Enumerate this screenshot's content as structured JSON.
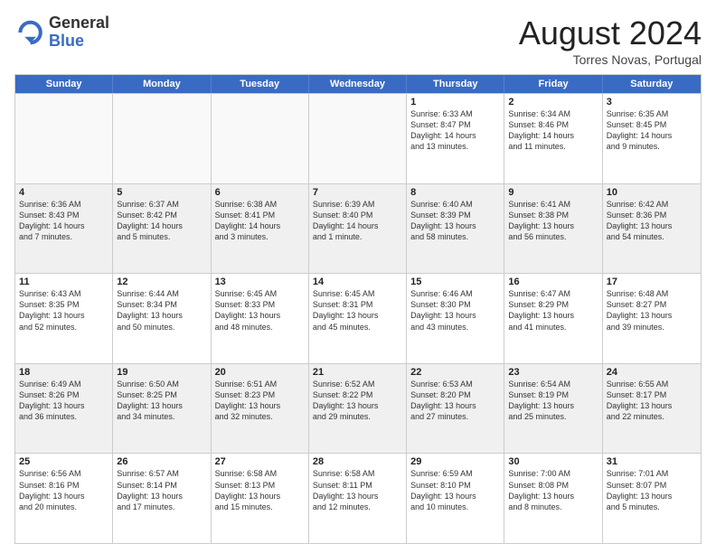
{
  "logo": {
    "general": "General",
    "blue": "Blue"
  },
  "title": "August 2024",
  "subtitle": "Torres Novas, Portugal",
  "header_days": [
    "Sunday",
    "Monday",
    "Tuesday",
    "Wednesday",
    "Thursday",
    "Friday",
    "Saturday"
  ],
  "weeks": [
    [
      {
        "day": "",
        "text": ""
      },
      {
        "day": "",
        "text": ""
      },
      {
        "day": "",
        "text": ""
      },
      {
        "day": "",
        "text": ""
      },
      {
        "day": "1",
        "text": "Sunrise: 6:33 AM\nSunset: 8:47 PM\nDaylight: 14 hours\nand 13 minutes."
      },
      {
        "day": "2",
        "text": "Sunrise: 6:34 AM\nSunset: 8:46 PM\nDaylight: 14 hours\nand 11 minutes."
      },
      {
        "day": "3",
        "text": "Sunrise: 6:35 AM\nSunset: 8:45 PM\nDaylight: 14 hours\nand 9 minutes."
      }
    ],
    [
      {
        "day": "4",
        "text": "Sunrise: 6:36 AM\nSunset: 8:43 PM\nDaylight: 14 hours\nand 7 minutes."
      },
      {
        "day": "5",
        "text": "Sunrise: 6:37 AM\nSunset: 8:42 PM\nDaylight: 14 hours\nand 5 minutes."
      },
      {
        "day": "6",
        "text": "Sunrise: 6:38 AM\nSunset: 8:41 PM\nDaylight: 14 hours\nand 3 minutes."
      },
      {
        "day": "7",
        "text": "Sunrise: 6:39 AM\nSunset: 8:40 PM\nDaylight: 14 hours\nand 1 minute."
      },
      {
        "day": "8",
        "text": "Sunrise: 6:40 AM\nSunset: 8:39 PM\nDaylight: 13 hours\nand 58 minutes."
      },
      {
        "day": "9",
        "text": "Sunrise: 6:41 AM\nSunset: 8:38 PM\nDaylight: 13 hours\nand 56 minutes."
      },
      {
        "day": "10",
        "text": "Sunrise: 6:42 AM\nSunset: 8:36 PM\nDaylight: 13 hours\nand 54 minutes."
      }
    ],
    [
      {
        "day": "11",
        "text": "Sunrise: 6:43 AM\nSunset: 8:35 PM\nDaylight: 13 hours\nand 52 minutes."
      },
      {
        "day": "12",
        "text": "Sunrise: 6:44 AM\nSunset: 8:34 PM\nDaylight: 13 hours\nand 50 minutes."
      },
      {
        "day": "13",
        "text": "Sunrise: 6:45 AM\nSunset: 8:33 PM\nDaylight: 13 hours\nand 48 minutes."
      },
      {
        "day": "14",
        "text": "Sunrise: 6:45 AM\nSunset: 8:31 PM\nDaylight: 13 hours\nand 45 minutes."
      },
      {
        "day": "15",
        "text": "Sunrise: 6:46 AM\nSunset: 8:30 PM\nDaylight: 13 hours\nand 43 minutes."
      },
      {
        "day": "16",
        "text": "Sunrise: 6:47 AM\nSunset: 8:29 PM\nDaylight: 13 hours\nand 41 minutes."
      },
      {
        "day": "17",
        "text": "Sunrise: 6:48 AM\nSunset: 8:27 PM\nDaylight: 13 hours\nand 39 minutes."
      }
    ],
    [
      {
        "day": "18",
        "text": "Sunrise: 6:49 AM\nSunset: 8:26 PM\nDaylight: 13 hours\nand 36 minutes."
      },
      {
        "day": "19",
        "text": "Sunrise: 6:50 AM\nSunset: 8:25 PM\nDaylight: 13 hours\nand 34 minutes."
      },
      {
        "day": "20",
        "text": "Sunrise: 6:51 AM\nSunset: 8:23 PM\nDaylight: 13 hours\nand 32 minutes."
      },
      {
        "day": "21",
        "text": "Sunrise: 6:52 AM\nSunset: 8:22 PM\nDaylight: 13 hours\nand 29 minutes."
      },
      {
        "day": "22",
        "text": "Sunrise: 6:53 AM\nSunset: 8:20 PM\nDaylight: 13 hours\nand 27 minutes."
      },
      {
        "day": "23",
        "text": "Sunrise: 6:54 AM\nSunset: 8:19 PM\nDaylight: 13 hours\nand 25 minutes."
      },
      {
        "day": "24",
        "text": "Sunrise: 6:55 AM\nSunset: 8:17 PM\nDaylight: 13 hours\nand 22 minutes."
      }
    ],
    [
      {
        "day": "25",
        "text": "Sunrise: 6:56 AM\nSunset: 8:16 PM\nDaylight: 13 hours\nand 20 minutes."
      },
      {
        "day": "26",
        "text": "Sunrise: 6:57 AM\nSunset: 8:14 PM\nDaylight: 13 hours\nand 17 minutes."
      },
      {
        "day": "27",
        "text": "Sunrise: 6:58 AM\nSunset: 8:13 PM\nDaylight: 13 hours\nand 15 minutes."
      },
      {
        "day": "28",
        "text": "Sunrise: 6:58 AM\nSunset: 8:11 PM\nDaylight: 13 hours\nand 12 minutes."
      },
      {
        "day": "29",
        "text": "Sunrise: 6:59 AM\nSunset: 8:10 PM\nDaylight: 13 hours\nand 10 minutes."
      },
      {
        "day": "30",
        "text": "Sunrise: 7:00 AM\nSunset: 8:08 PM\nDaylight: 13 hours\nand 8 minutes."
      },
      {
        "day": "31",
        "text": "Sunrise: 7:01 AM\nSunset: 8:07 PM\nDaylight: 13 hours\nand 5 minutes."
      }
    ]
  ]
}
